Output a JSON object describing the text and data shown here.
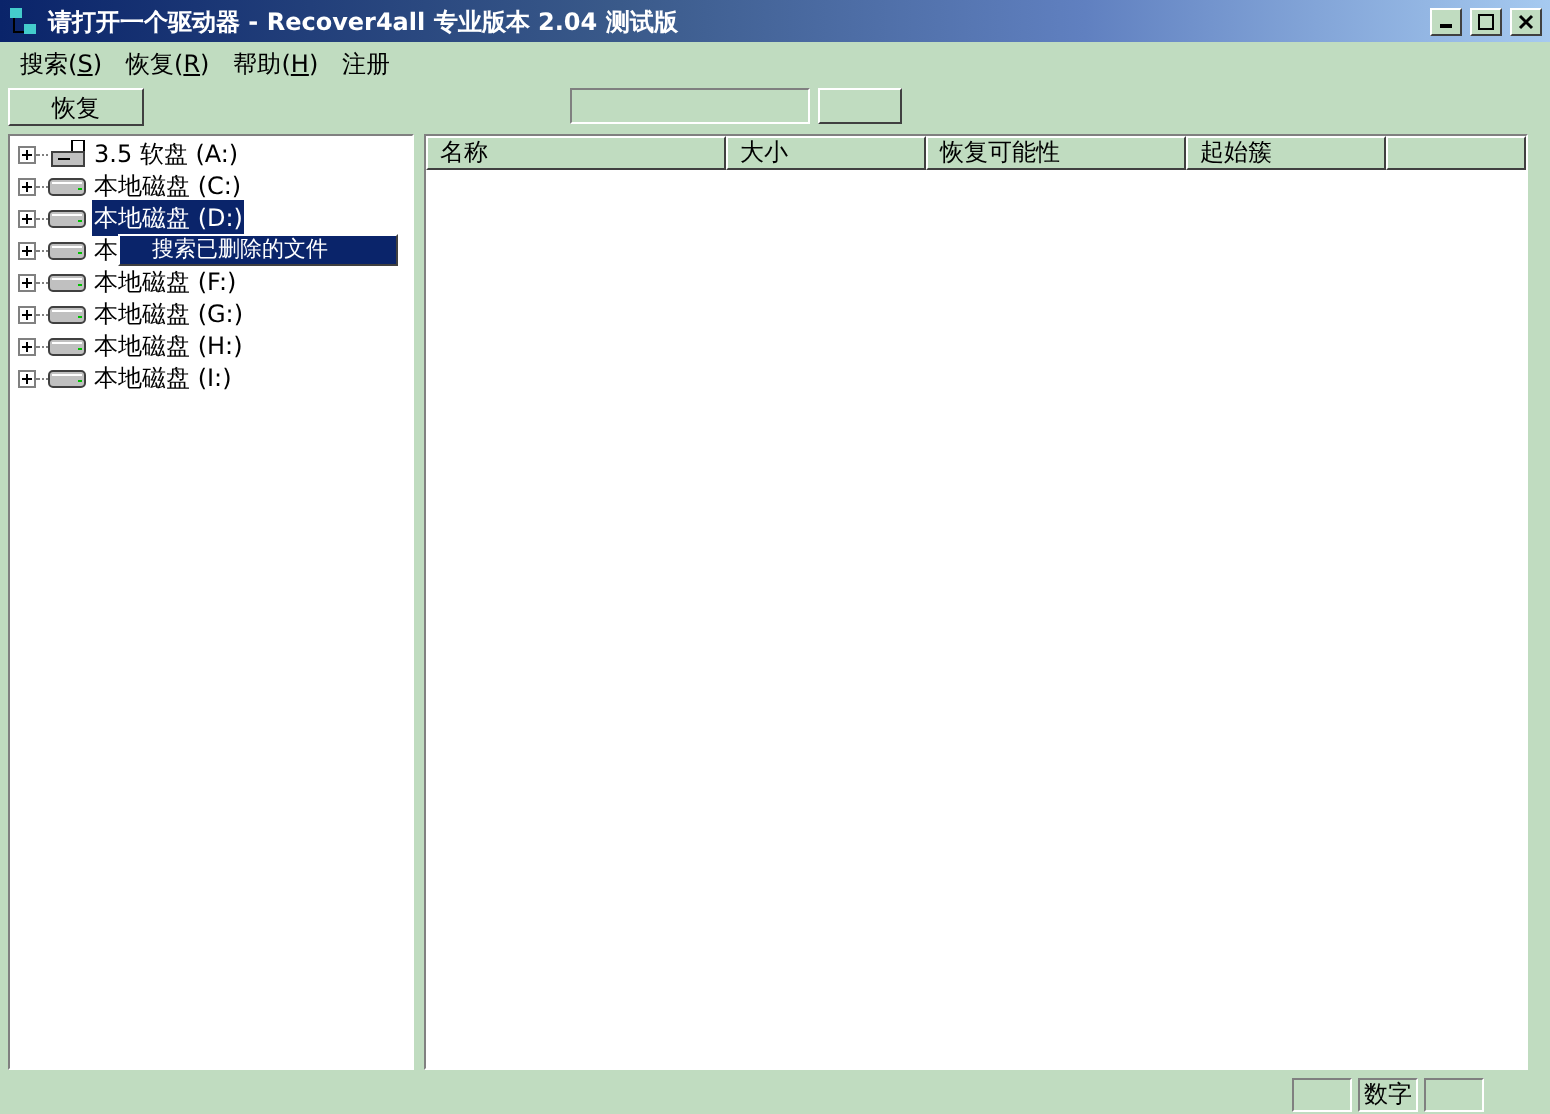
{
  "window": {
    "title": "请打开一个驱动器 - Recover4all 专业版本 2.04 测试版"
  },
  "menu": [
    {
      "label": "搜索(",
      "key": "S",
      "end": ")"
    },
    {
      "label": "恢复(",
      "key": "R",
      "end": ")"
    },
    {
      "label": "帮助(",
      "key": "H",
      "end": ")"
    },
    {
      "label": "注册"
    }
  ],
  "toolbar": {
    "restore_button": "恢复",
    "progress": {
      "level": 0
    }
  },
  "drives": [
    {
      "kind": "floppy",
      "label": "3.5 软盘 (A:)",
      "selected": false
    },
    {
      "kind": "disk",
      "label": "本地磁盘 (C:)",
      "selected": false
    },
    {
      "kind": "disk",
      "label": "本地磁盘 (D:)",
      "selected": true
    },
    {
      "kind": "disk",
      "label": "本",
      "selected": false
    },
    {
      "kind": "disk",
      "label": "本地磁盘 (F:)",
      "selected": false
    },
    {
      "kind": "disk",
      "label": "本地磁盘 (G:)",
      "selected": false
    },
    {
      "kind": "disk",
      "label": "本地磁盘 (H:)",
      "selected": false
    },
    {
      "kind": "disk",
      "label": "本地磁盘 (I:)",
      "selected": false
    }
  ],
  "context_menu": {
    "items": [
      "搜索已删除的文件"
    ]
  },
  "table": {
    "columns": [
      "名称",
      "大小",
      "恢复可能性",
      "起始簇"
    ]
  },
  "status_bar": {
    "indicator": "数字"
  }
}
